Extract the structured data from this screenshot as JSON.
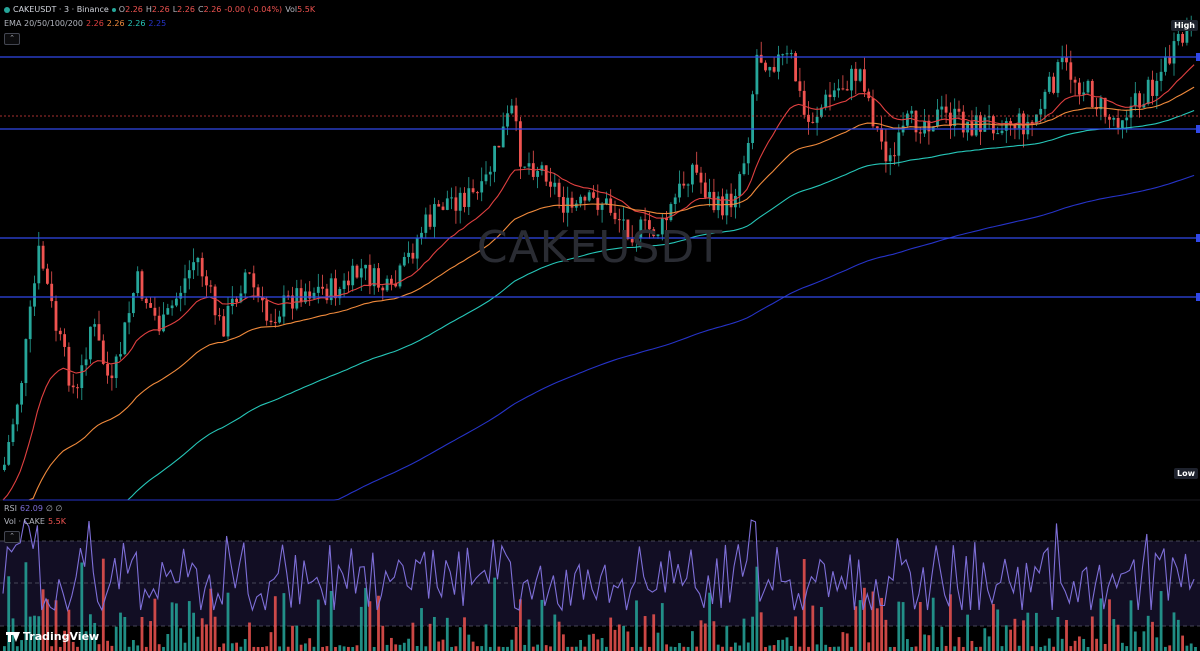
{
  "symbol": {
    "title": "CAKEUSDT · 3 · Binance",
    "ohlc": {
      "o_label": "O",
      "o": "2.26",
      "h_label": "H",
      "h": "2.26",
      "l_label": "L",
      "l": "2.26",
      "c_label": "C",
      "c": "2.26",
      "change": "-0.00 (-0.04%)",
      "vol_label": "Vol",
      "vol": "5.5K"
    }
  },
  "ema": {
    "label": "EMA 20/50/100/200",
    "v1": "2.26",
    "v2": "2.26",
    "v3": "2.26",
    "v4": "2.25"
  },
  "rsi": {
    "label": "RSI",
    "value": "62.09",
    "extra": "∅ ∅"
  },
  "volume": {
    "label": "Vol · CAKE",
    "value": "5.5K"
  },
  "watermark": "CAKEUSDT",
  "axis": {
    "high": "High",
    "low": "Low"
  },
  "brand": "TradingView",
  "collapse_icons": {
    "top": "⌃",
    "bottom": "⌃"
  },
  "colors": {
    "up": "#26a69a",
    "down": "#ef5350",
    "ema20": "#e04040",
    "ema50": "#f08a3c",
    "ema100": "#26c6b8",
    "ema200": "#2633c8",
    "hline": "#3148e8",
    "rsi": "#7e6fd8",
    "background": "#000000"
  },
  "chart_data": {
    "type": "candlestick",
    "symbol": "CAKEUSDT",
    "timeframe": "3",
    "exchange": "Binance",
    "horizontal_levels_count": 4,
    "dashed_level": "current price (red dotted line)",
    "indicators": [
      "EMA 20",
      "EMA 50",
      "EMA 100",
      "EMA 200",
      "RSI",
      "Volume"
    ],
    "trend": "uptrend from left low to right highs",
    "rsi_bands": [
      "70",
      "50",
      "30"
    ]
  }
}
